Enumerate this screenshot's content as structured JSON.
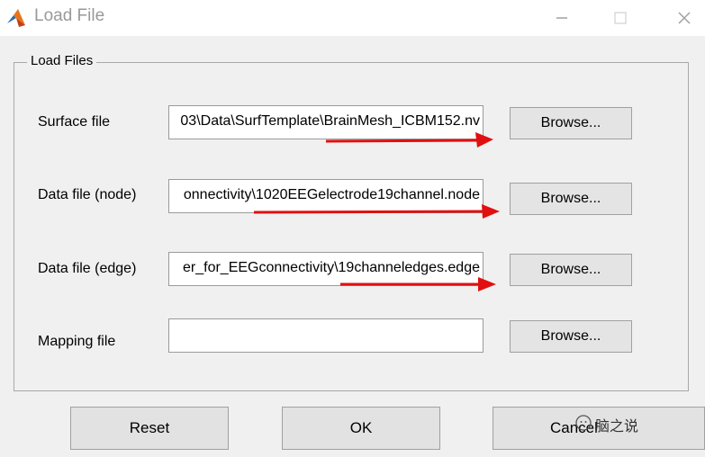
{
  "window": {
    "title": "Load File",
    "minimize_icon": "minimize-icon",
    "maximize_icon": "maximize-icon",
    "close_icon": "close-icon"
  },
  "group": {
    "legend": "Load Files"
  },
  "rows": [
    {
      "label": "Surface file",
      "value": "03\\Data\\SurfTemplate\\BrainMesh_ICBM152.nv",
      "button": "Browse..."
    },
    {
      "label": "Data file (node)",
      "value": "onnectivity\\1020EEGelectrode19channel.node",
      "button": "Browse..."
    },
    {
      "label": "Data file (edge)",
      "value": "er_for_EEGconnectivity\\19channeledges.edge",
      "button": "Browse..."
    },
    {
      "label": "Mapping file",
      "value": "",
      "button": "Browse..."
    }
  ],
  "buttons": {
    "reset": "Reset",
    "ok": "OK",
    "cancel": "Cancel"
  },
  "watermark": {
    "text": "脑之说"
  },
  "colors": {
    "annotation_arrow": "#e01010"
  }
}
